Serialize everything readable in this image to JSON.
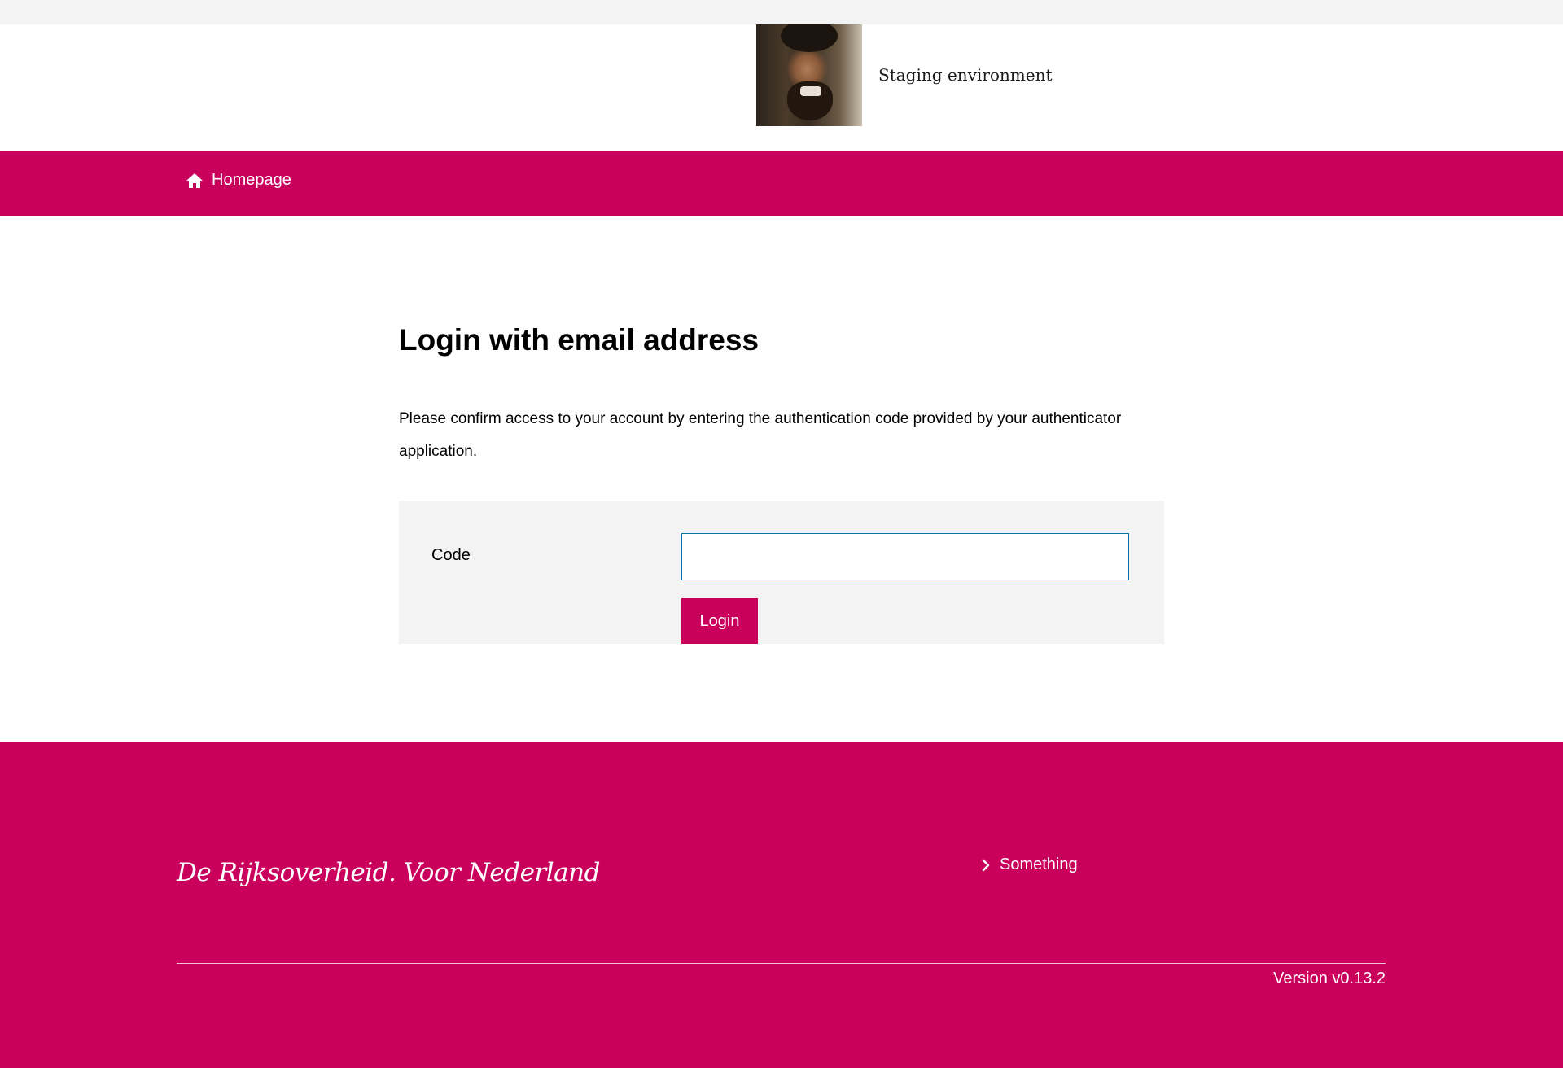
{
  "header": {
    "environment_label": "Staging environment",
    "logo_icon": "spartan-portrait"
  },
  "nav": {
    "home_icon": "home-icon",
    "home_label": "Homepage"
  },
  "main": {
    "title": "Login with email address",
    "intro": "Please confirm access to your account by entering the authentication code provided by your authenti­cator application.",
    "form": {
      "code_label": "Code",
      "code_value": "",
      "code_placeholder": "",
      "submit_label": "Login"
    }
  },
  "footer": {
    "tagline": "De Rijksoverheid. Voor Nederland",
    "link_icon": "chevron-right-icon",
    "link_label": "Something",
    "version": "Version v0.13.2"
  },
  "colors": {
    "brand": "#ca005d",
    "panel": "#f3f3f3",
    "input_border": "#0e6fa0",
    "top_strip": "#f3f3f3"
  }
}
